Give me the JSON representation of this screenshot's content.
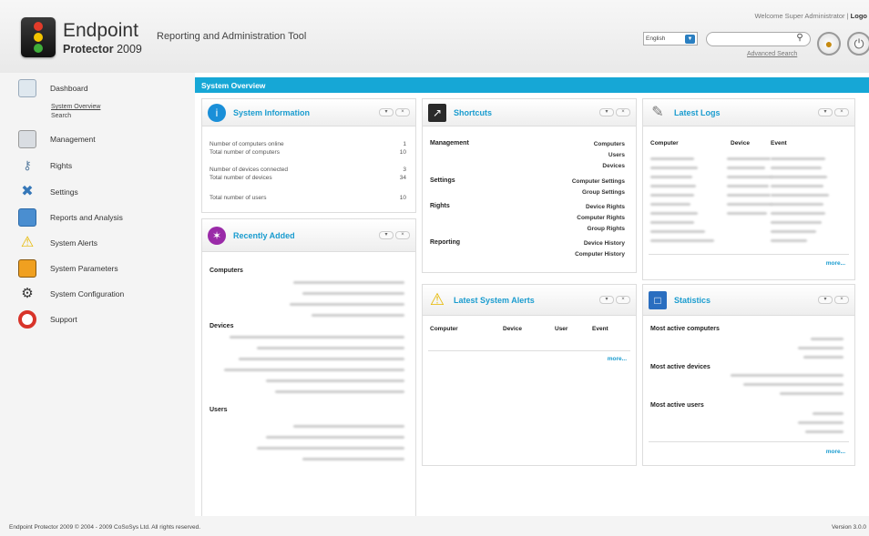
{
  "header": {
    "brand_line1": "Endpoint",
    "brand_line2_bold": "Protector",
    "brand_line2_year": "2009",
    "tagline": "Reporting and Administration Tool",
    "welcome_text": "Welcome Super Administrator",
    "logout_label": "Logo",
    "language_value": "English",
    "search_placeholder": "",
    "advanced_search_label": "Advanced Search"
  },
  "sidebar": {
    "items": [
      {
        "label": "Dashboard",
        "icon": "dashboard-icon"
      },
      {
        "label": "Management",
        "icon": "management-icon"
      },
      {
        "label": "Rights",
        "icon": "rights-icon"
      },
      {
        "label": "Settings",
        "icon": "settings-icon"
      },
      {
        "label": "Reports and Analysis",
        "icon": "reports-icon"
      },
      {
        "label": "System Alerts",
        "icon": "alert-icon"
      },
      {
        "label": "System Parameters",
        "icon": "parameters-icon"
      },
      {
        "label": "System Configuration",
        "icon": "configuration-icon"
      },
      {
        "label": "Support",
        "icon": "support-icon"
      }
    ],
    "subitems": [
      {
        "label": "System Overview"
      },
      {
        "label": "Search"
      }
    ]
  },
  "main": {
    "title": "System Overview"
  },
  "system_information": {
    "title": "System Information",
    "rows": [
      {
        "label": "Number of computers online",
        "value": "1"
      },
      {
        "label": "Total number of computers",
        "value": "10"
      },
      {
        "label": "Number of devices connected",
        "value": "3"
      },
      {
        "label": "Total number of devices",
        "value": "34"
      },
      {
        "label": "Total number of users",
        "value": "10"
      }
    ]
  },
  "recently_added": {
    "title": "Recently Added",
    "sections": [
      "Computers",
      "Devices",
      "Users"
    ]
  },
  "shortcuts": {
    "title": "Shortcuts",
    "groups": [
      {
        "name": "Management",
        "links": [
          "Computers",
          "Users",
          "Devices"
        ]
      },
      {
        "name": "Settings",
        "links": [
          "Computer Settings",
          "Group Settings"
        ]
      },
      {
        "name": "Rights",
        "links": [
          "Device Rights",
          "Computer Rights",
          "Group Rights"
        ]
      },
      {
        "name": "Reporting",
        "links": [
          "Device History",
          "Computer History"
        ]
      }
    ]
  },
  "latest_logs": {
    "title": "Latest Logs",
    "columns": [
      "Computer",
      "Device",
      "Event"
    ],
    "more_label": "more..."
  },
  "latest_alerts": {
    "title": "Latest System Alerts",
    "columns": [
      "Computer",
      "Device",
      "User",
      "Event"
    ],
    "more_label": "more..."
  },
  "statistics": {
    "title": "Statistics",
    "sections": [
      "Most active computers",
      "Most active devices",
      "Most active users"
    ],
    "more_label": "more..."
  },
  "footer": {
    "left_text": "Endpoint Protector 2009   © 2004 - 2009 CoSoSys Ltd. All rights reserved.",
    "version": "Version 3.0.0"
  },
  "colors": {
    "accent": "#16a7d6",
    "panel_title": "#1a9ccf"
  }
}
